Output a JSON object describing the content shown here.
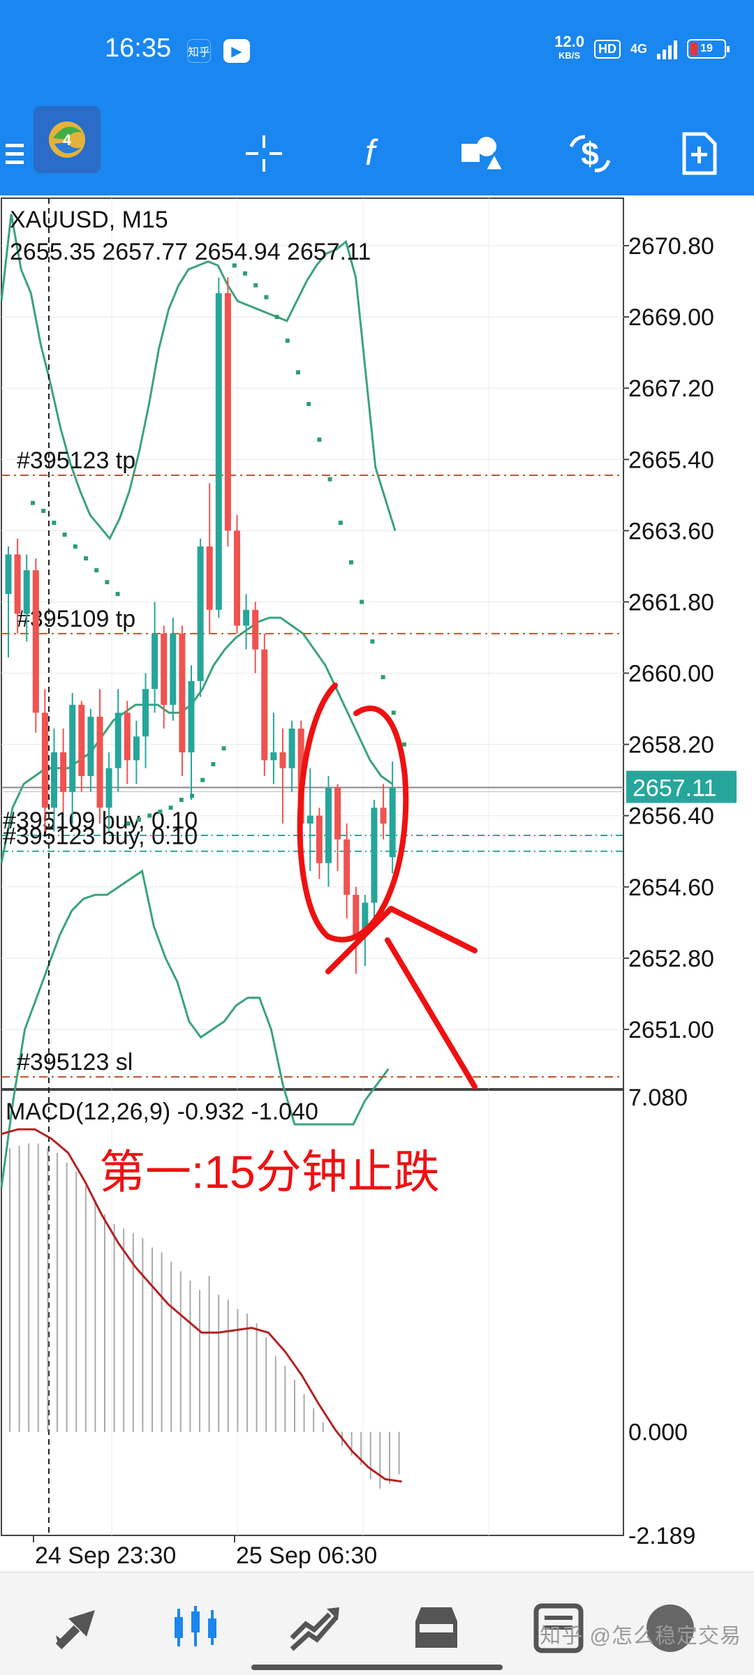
{
  "status_bar": {
    "time": "16:35",
    "app_icon_1": "知乎",
    "app_icon_2": "▶",
    "net_speed": "12.0",
    "net_speed_unit": "KB/S",
    "hd": "HD",
    "network": "4G",
    "battery": "19"
  },
  "toolbar": {
    "icons": [
      "menu-icon",
      "metatrader-logo-icon",
      "crosshair-icon",
      "indicators-icon",
      "objects-icon",
      "trade-icon",
      "new-document-icon"
    ]
  },
  "bottom_nav": {
    "items": [
      "quotes-icon",
      "chart-icon",
      "trade-icon",
      "history-icon",
      "messages-icon",
      "avatar-icon"
    ],
    "active": "chart-icon",
    "watermark": "知乎 @怎么稳定交易"
  },
  "colors": {
    "bull": "#26a69a",
    "bear": "#ef5350",
    "bands": "#3aa37b",
    "sar": "#2e9d6e",
    "order_line": "#c0552b",
    "buy_line": "#26a69a",
    "macd_signal": "#b22222",
    "annotation": "#ee1111",
    "price_tag": "#26a69a"
  },
  "chart_data": [
    {
      "type": "candlestick",
      "symbol": "XAUUSD, M15",
      "ohlc_label": "2655.35 2657.77 2654.94 2657.11",
      "ylim": [
        2649.5,
        2672.0
      ],
      "y_ticks": [
        "2670.80",
        "2669.00",
        "2667.20",
        "2665.40",
        "2663.60",
        "2661.80",
        "2660.00",
        "2658.20",
        "2656.40",
        "2654.60",
        "2652.80",
        "2651.00"
      ],
      "y_tick_values": [
        2670.8,
        2669.0,
        2667.2,
        2665.4,
        2663.6,
        2661.8,
        2660.0,
        2658.2,
        2656.4,
        2654.6,
        2652.8,
        2651.0
      ],
      "current_price": "2657.11",
      "current_price_value": 2657.11,
      "order_lines": [
        {
          "label": "#395123 tp",
          "price": 2665.0
        },
        {
          "label": "#395109 tp",
          "price": 2661.0
        },
        {
          "label": "#395109 buy, 0.10",
          "price": 2655.9
        },
        {
          "label": "#395123 buy, 0.10",
          "price": 2655.5
        },
        {
          "label": "#395123 sl",
          "price": 2649.8
        }
      ],
      "candles": [
        [
          2662.0,
          2663.2,
          2660.4,
          2663.0
        ],
        [
          2663.0,
          2663.4,
          2661.0,
          2661.5
        ],
        [
          2661.5,
          2663.0,
          2660.8,
          2662.6
        ],
        [
          2662.6,
          2662.9,
          2658.5,
          2659.0
        ],
        [
          2659.0,
          2659.6,
          2656.0,
          2656.6
        ],
        [
          2656.6,
          2658.6,
          2656.0,
          2658.0
        ],
        [
          2658.0,
          2658.6,
          2656.5,
          2657.0
        ],
        [
          2657.0,
          2659.5,
          2656.2,
          2659.2
        ],
        [
          2659.2,
          2659.3,
          2657.0,
          2657.4
        ],
        [
          2657.4,
          2659.1,
          2657.0,
          2658.9
        ],
        [
          2658.9,
          2659.6,
          2656.2,
          2656.6
        ],
        [
          2656.6,
          2658.0,
          2656.0,
          2657.6
        ],
        [
          2657.6,
          2659.6,
          2657.0,
          2659.0
        ],
        [
          2659.0,
          2659.3,
          2657.2,
          2657.8
        ],
        [
          2657.8,
          2658.8,
          2657.2,
          2658.4
        ],
        [
          2658.4,
          2660.0,
          2657.6,
          2659.6
        ],
        [
          2659.6,
          2661.8,
          2659.0,
          2661.0
        ],
        [
          2661.0,
          2661.2,
          2658.6,
          2659.2
        ],
        [
          2659.2,
          2661.4,
          2658.8,
          2661.0
        ],
        [
          2661.0,
          2661.2,
          2657.4,
          2658.0
        ],
        [
          2658.0,
          2660.2,
          2656.8,
          2659.8
        ],
        [
          2659.8,
          2663.4,
          2659.4,
          2663.2
        ],
        [
          2663.2,
          2664.8,
          2661.0,
          2661.6
        ],
        [
          2661.6,
          2670.0,
          2661.4,
          2669.6
        ],
        [
          2669.6,
          2670.0,
          2663.2,
          2663.6
        ],
        [
          2663.6,
          2664.0,
          2661.0,
          2661.2
        ],
        [
          2661.2,
          2662.0,
          2660.6,
          2661.6
        ],
        [
          2661.6,
          2661.8,
          2660.0,
          2660.6
        ],
        [
          2660.6,
          2661.0,
          2657.4,
          2657.8
        ],
        [
          2657.8,
          2659.0,
          2657.2,
          2658.0
        ],
        [
          2658.0,
          2658.6,
          2656.2,
          2657.6
        ],
        [
          2657.6,
          2658.8,
          2657.0,
          2658.6
        ],
        [
          2658.6,
          2658.8,
          2655.6,
          2656.2
        ],
        [
          2656.2,
          2657.6,
          2655.0,
          2656.4
        ],
        [
          2656.4,
          2656.6,
          2654.8,
          2655.2
        ],
        [
          2655.2,
          2657.4,
          2654.6,
          2657.1
        ],
        [
          2657.1,
          2657.2,
          2655.0,
          2655.8
        ],
        [
          2655.8,
          2656.2,
          2653.8,
          2654.4
        ],
        [
          2654.4,
          2654.6,
          2652.4,
          2653.4
        ],
        [
          2653.4,
          2654.4,
          2652.6,
          2654.2
        ],
        [
          2654.2,
          2656.8,
          2653.8,
          2656.6
        ],
        [
          2656.6,
          2657.2,
          2655.8,
          2656.2
        ],
        [
          2655.35,
          2657.77,
          2654.94,
          2657.11
        ]
      ],
      "bollinger": {
        "upper": [
          2669.4,
          2671.6,
          2670.2,
          2669.6,
          2668.3,
          2667.3,
          2666.2,
          2665.3,
          2664.6,
          2664.0,
          2663.7,
          2663.4,
          2663.9,
          2664.6,
          2665.6,
          2666.8,
          2668.2,
          2669.2,
          2669.8,
          2670.2,
          2670.3,
          2670.4,
          2670.3,
          2669.8,
          2669.4,
          2669.3,
          2669.2,
          2669.1,
          2669.0,
          2668.9,
          2669.4,
          2669.9,
          2670.3,
          2670.6,
          2670.7,
          2670.9,
          2670.0,
          2667.6,
          2665.2,
          2664.4,
          2663.6
        ],
        "middle": [
          2655.2,
          2656.6,
          2657.2,
          2657.4,
          2657.6,
          2657.6,
          2657.6,
          2657.8,
          2658.0,
          2658.4,
          2658.8,
          2659.0,
          2659.2,
          2659.2,
          2659.2,
          2659.0,
          2659.0,
          2659.2,
          2659.6,
          2660.2,
          2660.6,
          2660.9,
          2661.1,
          2661.3,
          2661.4,
          2661.4,
          2661.2,
          2661.0,
          2660.6,
          2660.2,
          2659.6,
          2659.0,
          2658.4,
          2657.8,
          2657.4,
          2657.2
        ],
        "lower": [
          2647.0,
          2649.2,
          2651.0,
          2651.8,
          2652.6,
          2653.4,
          2654.0,
          2654.3,
          2654.4,
          2654.4,
          2654.6,
          2654.8,
          2655.0,
          2653.6,
          2652.8,
          2652.2,
          2651.2,
          2650.8,
          2651.0,
          2651.2,
          2651.6,
          2651.8,
          2651.8,
          2651.0,
          2649.6,
          2648.6,
          2648.6,
          2648.6,
          2648.6,
          2648.6,
          2648.6,
          2649.2,
          2649.6,
          2650.0
        ]
      },
      "parabolic_sar": [
        2664.3,
        2664.1,
        2663.8,
        2663.5,
        2663.2,
        2662.9,
        2662.6,
        2662.3,
        2662.0,
        2656.2,
        2656.3,
        2656.4,
        2656.5,
        2656.6,
        2656.8,
        2656.9,
        2657.3,
        2657.7,
        2658.1,
        2670.3,
        2670.1,
        2669.8,
        2669.5,
        2669.0,
        2668.4,
        2667.6,
        2666.8,
        2665.9,
        2664.9,
        2663.8,
        2662.8,
        2661.8,
        2660.8,
        2659.9,
        2659.0,
        2658.2
      ],
      "x_labels": [
        "24 Sep 23:30",
        "25 Sep 06:30"
      ]
    },
    {
      "type": "macd",
      "label": "MACD(12,26,9) -0.932 -1.040",
      "ylim": [
        -2.189,
        7.08
      ],
      "y_ticks": [
        "7.080",
        "0.000",
        "-2.189"
      ],
      "y_tick_values": [
        7.08,
        0.0,
        -2.189
      ],
      "histogram": [
        6.0,
        6.05,
        6.1,
        6.1,
        6.0,
        5.9,
        5.7,
        5.5,
        5.2,
        4.9,
        4.6,
        4.4,
        4.3,
        4.2,
        4.1,
        3.9,
        3.8,
        3.6,
        3.4,
        3.2,
        3.0,
        3.3,
        2.9,
        2.8,
        2.6,
        2.5,
        2.3,
        2.0,
        1.6,
        1.4,
        1.1,
        0.8,
        0.5,
        0.2,
        0.0,
        -0.3,
        -0.5,
        -0.7,
        -1.0,
        -1.2,
        -1.1,
        -0.9
      ],
      "signal": [
        6.3,
        6.4,
        6.4,
        6.2,
        5.9,
        5.3,
        4.6,
        4.0,
        3.5,
        3.1,
        2.7,
        2.4,
        2.1,
        2.1,
        2.15,
        2.2,
        2.1,
        1.7,
        1.2,
        0.6,
        0.05,
        -0.4,
        -0.75,
        -1.0,
        -1.05
      ],
      "annotation_text": "第一:15分钟止跌"
    }
  ]
}
